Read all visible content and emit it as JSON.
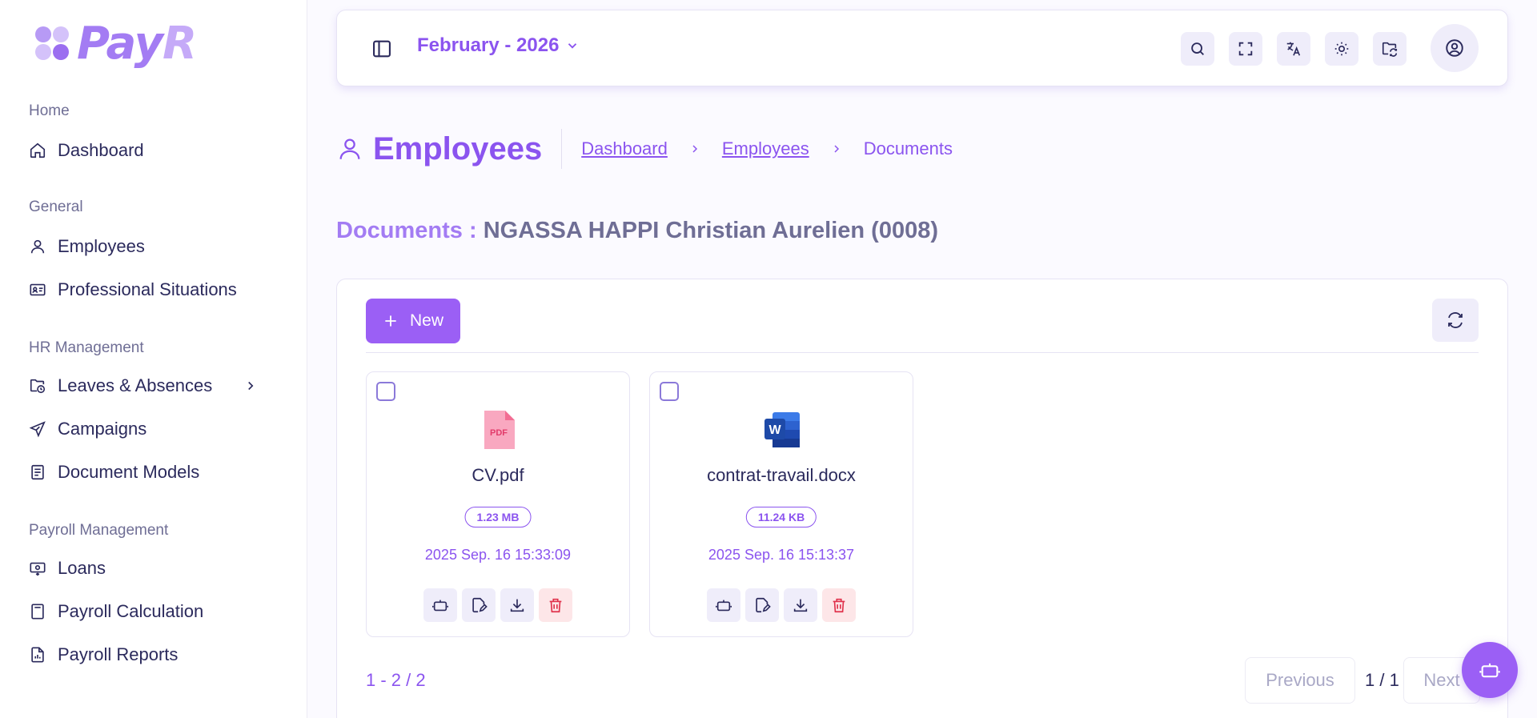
{
  "brand": {
    "name": "Pay",
    "name_suffix": "R",
    "accent": "#8b54ef"
  },
  "sidebar": {
    "sections": [
      {
        "label": "Home"
      },
      {
        "label": "General"
      },
      {
        "label": "HR Management"
      },
      {
        "label": "Payroll Management"
      }
    ],
    "items": [
      {
        "label": "Dashboard",
        "icon": "home-icon"
      },
      {
        "label": "Employees",
        "icon": "user-icon"
      },
      {
        "label": "Professional Situations",
        "icon": "id-card-icon"
      },
      {
        "label": "Leaves & Absences",
        "icon": "folder-clock-icon",
        "has_submenu": true
      },
      {
        "label": "Campaigns",
        "icon": "send-icon"
      },
      {
        "label": "Document Models",
        "icon": "document-icon"
      },
      {
        "label": "Loans",
        "icon": "money-icon"
      },
      {
        "label": "Payroll Calculation",
        "icon": "calculator-icon"
      },
      {
        "label": "Payroll Reports",
        "icon": "report-icon"
      }
    ]
  },
  "topbar": {
    "period": "February - 2026",
    "buttons": [
      "search-icon",
      "fullscreen-icon",
      "translate-icon",
      "sun-icon",
      "folder-sync-icon"
    ],
    "avatar_icon": "user-circle-icon"
  },
  "page": {
    "title": "Employees",
    "breadcrumb": [
      "Dashboard",
      "Employees",
      "Documents"
    ],
    "doc_label": "Documents : ",
    "employee_name": "NGASSA HAPPI Christian Aurelien (0008)"
  },
  "toolbar": {
    "new_label": "New"
  },
  "files": [
    {
      "name": "CV.pdf",
      "type": "pdf",
      "size": "1.23 MB",
      "date": "2025 Sep. 16 15:33:09"
    },
    {
      "name": "contrat-travail.docx",
      "type": "docx",
      "size": "11.24 KB",
      "date": "2025 Sep. 16 15:13:37"
    }
  ],
  "pagination": {
    "range": "1 - 2 / 2",
    "previous": "Previous",
    "page": "1 / 1",
    "next": "Next"
  }
}
